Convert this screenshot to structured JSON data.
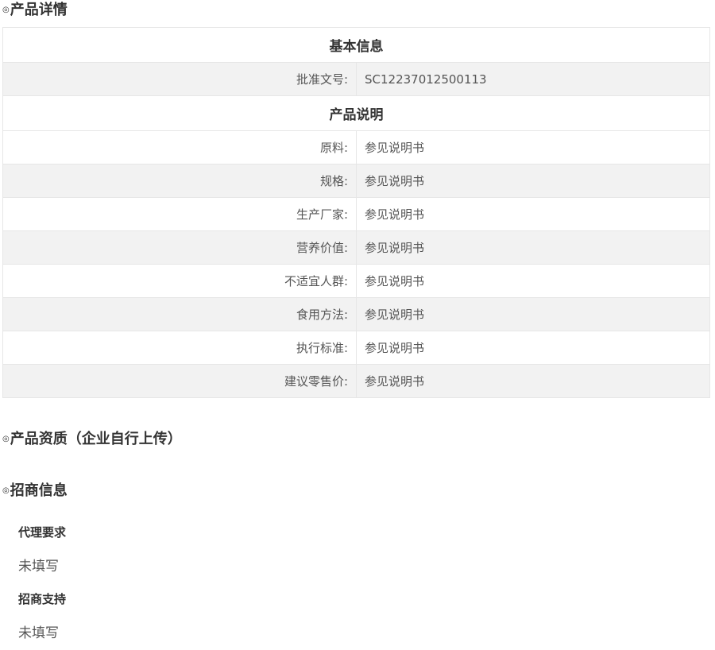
{
  "sections": {
    "details": {
      "bullet": "◎",
      "title": "产品详情"
    },
    "qualifications": {
      "bullet": "◎",
      "title": "产品资质（企业自行上传）"
    },
    "investment": {
      "bullet": "◎",
      "title": "招商信息"
    }
  },
  "basic_info": {
    "heading": "基本信息",
    "rows": [
      {
        "label": "批准文号:",
        "value": "SC12237012500113"
      }
    ]
  },
  "product_desc": {
    "heading": "产品说明",
    "rows": [
      {
        "label": "原料:",
        "value": "参见说明书"
      },
      {
        "label": "规格:",
        "value": "参见说明书"
      },
      {
        "label": "生产厂家:",
        "value": "参见说明书"
      },
      {
        "label": "营养价值:",
        "value": "参见说明书"
      },
      {
        "label": "不适宜人群:",
        "value": "参见说明书"
      },
      {
        "label": "食用方法:",
        "value": "参见说明书"
      },
      {
        "label": "执行标准:",
        "value": "参见说明书"
      },
      {
        "label": "建议零售价:",
        "value": "参见说明书"
      }
    ]
  },
  "investment_info": {
    "items": [
      {
        "title": "代理要求",
        "value": "未填写"
      },
      {
        "title": "招商支持",
        "value": "未填写"
      }
    ]
  }
}
